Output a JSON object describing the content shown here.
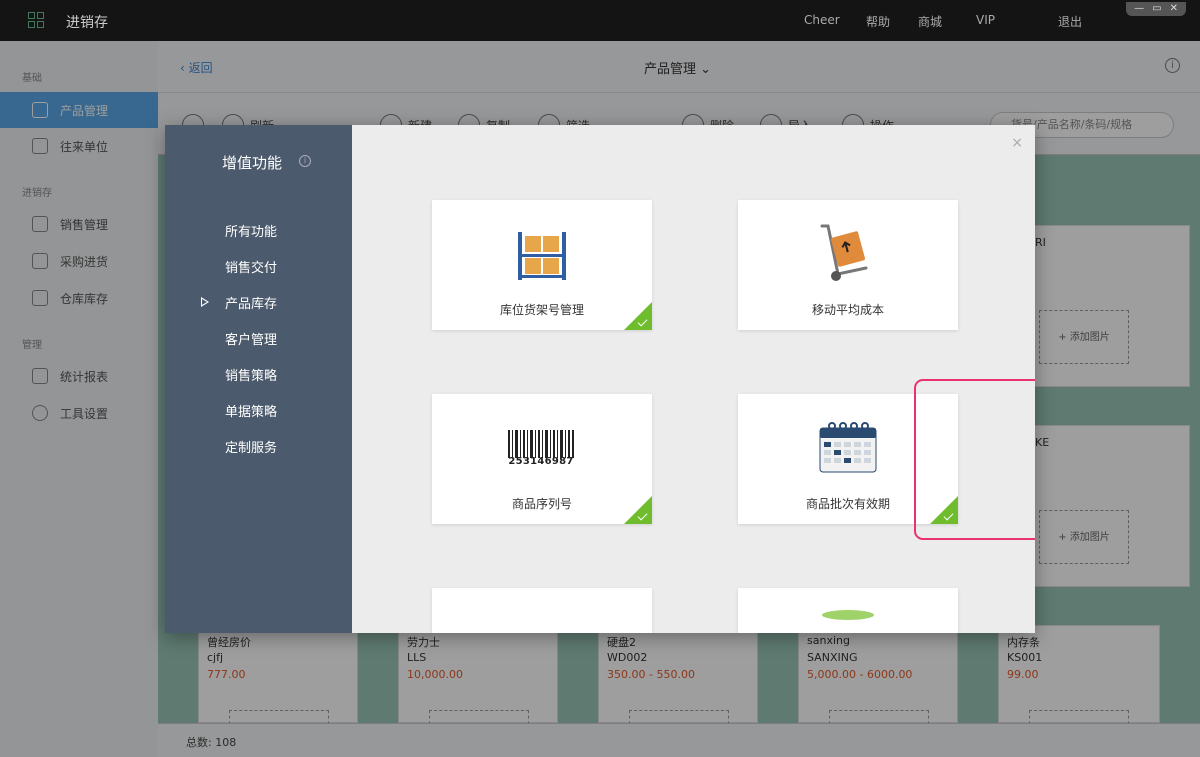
{
  "titlebar": {
    "app_title": "进销存",
    "menu": [
      "Cheer",
      "帮助",
      "商城",
      "VIP",
      "退出"
    ],
    "window_controls": [
      "—",
      "▭",
      "✕"
    ]
  },
  "sidebar": {
    "sections": [
      {
        "label": "基础",
        "items": [
          {
            "label": "产品管理",
            "icon": "tag-icon",
            "active": true
          },
          {
            "label": "往来单位",
            "icon": "contacts-icon"
          }
        ]
      },
      {
        "label": "进销存",
        "items": [
          {
            "label": "销售管理",
            "icon": "clipboard-icon"
          },
          {
            "label": "采购进货",
            "icon": "cart-icon"
          },
          {
            "label": "仓库库存",
            "icon": "warehouse-icon"
          }
        ]
      },
      {
        "label": "管理",
        "items": [
          {
            "label": "统计报表",
            "icon": "chart-icon"
          },
          {
            "label": "工具设置",
            "icon": "gear-icon"
          }
        ]
      }
    ]
  },
  "main": {
    "back_label": "返回",
    "page_title": "产品管理",
    "toolbar": {
      "refresh": "刷新",
      "new": "新建",
      "copy": "复制",
      "filter": "筛选",
      "delete": "删除",
      "import": "导入",
      "action": "操作",
      "search_placeholder": "货号/产品名称/条码/规格"
    },
    "right_partial_cards": [
      {
        "name": "RI"
      },
      {
        "name": "KE"
      }
    ],
    "add_image_label": "+ 添加图片",
    "products": [
      {
        "name": "曾经房价",
        "code": "cjfj",
        "price": "777.00"
      },
      {
        "name": "劳力士",
        "code": "LLS",
        "price": "10,000.00"
      },
      {
        "name": "硬盘2",
        "code": "WD002",
        "price": "350.00 - 550.00"
      },
      {
        "name": "sanxing",
        "code": "SANXING",
        "price": "5,000.00 - 6000.00"
      },
      {
        "name": "内存条",
        "code": "KS001",
        "price": "99.00"
      }
    ],
    "total_label": "总数:",
    "total_value": "108"
  },
  "modal": {
    "title": "增值功能",
    "info_icon": "ⓘ",
    "close_icon": "×",
    "nav": [
      "所有功能",
      "销售交付",
      "产品库存",
      "客户管理",
      "销售策略",
      "单据策略",
      "定制服务"
    ],
    "active_nav_index": 2,
    "features": [
      {
        "label": "库位货架号管理",
        "icon": "shelf-icon",
        "enabled": true
      },
      {
        "label": "移动平均成本",
        "icon": "hand-truck-icon",
        "enabled": false
      },
      {
        "label": "商品序列号",
        "icon": "barcode-icon",
        "barcode_text": "253146987",
        "enabled": true
      },
      {
        "label": "商品批次有效期",
        "icon": "calendar-icon",
        "enabled": true,
        "highlighted": true
      }
    ]
  },
  "colors": {
    "titlebar": "#141414",
    "modal_nav": "#4b5a6c",
    "check_green": "#6fbd2c",
    "highlight_pink": "#e8336f",
    "accent_blue": "#5ba7e6"
  }
}
